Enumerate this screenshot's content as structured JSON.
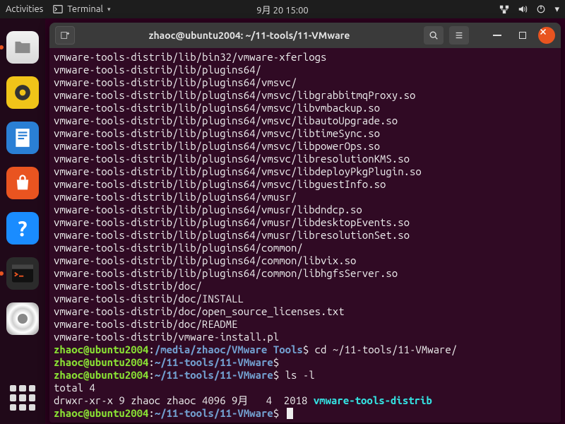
{
  "topbar": {
    "activities": "Activities",
    "app_menu": "Terminal",
    "datetime": "9月 20  15:00"
  },
  "dock": {
    "items": [
      {
        "name": "files",
        "label": "Files"
      },
      {
        "name": "rhythmbox",
        "label": "Rhythmbox"
      },
      {
        "name": "writer",
        "label": "LibreOffice Writer"
      },
      {
        "name": "software",
        "label": "Ubuntu Software"
      },
      {
        "name": "help",
        "label": "Help"
      },
      {
        "name": "terminal",
        "label": "Terminal"
      },
      {
        "name": "dvd",
        "label": "VMware Tools DVD"
      },
      {
        "name": "show-apps",
        "label": "Show Applications"
      }
    ]
  },
  "window": {
    "title": "zhaoc@ubuntu2004: ~/11-tools/11-VMware"
  },
  "terminal": {
    "output": [
      "vmware-tools-distrib/lib/bin32/vmware-xferlogs",
      "vmware-tools-distrib/lib/plugins64/",
      "vmware-tools-distrib/lib/plugins64/vmsvc/",
      "vmware-tools-distrib/lib/plugins64/vmsvc/libgrabbitmqProxy.so",
      "vmware-tools-distrib/lib/plugins64/vmsvc/libvmbackup.so",
      "vmware-tools-distrib/lib/plugins64/vmsvc/libautoUpgrade.so",
      "vmware-tools-distrib/lib/plugins64/vmsvc/libtimeSync.so",
      "vmware-tools-distrib/lib/plugins64/vmsvc/libpowerOps.so",
      "vmware-tools-distrib/lib/plugins64/vmsvc/libresolutionKMS.so",
      "vmware-tools-distrib/lib/plugins64/vmsvc/libdeployPkgPlugin.so",
      "vmware-tools-distrib/lib/plugins64/vmsvc/libguestInfo.so",
      "vmware-tools-distrib/lib/plugins64/vmusr/",
      "vmware-tools-distrib/lib/plugins64/vmusr/libdndcp.so",
      "vmware-tools-distrib/lib/plugins64/vmusr/libdesktopEvents.so",
      "vmware-tools-distrib/lib/plugins64/vmusr/libresolutionSet.so",
      "vmware-tools-distrib/lib/plugins64/common/",
      "vmware-tools-distrib/lib/plugins64/common/libvix.so",
      "vmware-tools-distrib/lib/plugins64/common/libhgfsServer.so",
      "vmware-tools-distrib/doc/",
      "vmware-tools-distrib/doc/INSTALL",
      "vmware-tools-distrib/doc/open_source_licenses.txt",
      "vmware-tools-distrib/doc/README",
      "vmware-tools-distrib/vmware-install.pl"
    ],
    "prompts": [
      {
        "user": "zhaoc@ubuntu2004",
        "sep": ":",
        "path": "/media/zhaoc/VMware Tools",
        "sym": "$",
        "cmd": " cd ~/11-tools/11-VMware/"
      },
      {
        "user": "zhaoc@ubuntu2004",
        "sep": ":",
        "path": "~/11-tools/11-VMware",
        "sym": "$",
        "cmd": ""
      },
      {
        "user": "zhaoc@ubuntu2004",
        "sep": ":",
        "path": "~/11-tools/11-VMware",
        "sym": "$",
        "cmd": " ls -l"
      }
    ],
    "ls_output": {
      "total": "total 4",
      "perm": "drwxr-xr-x 9 zhaoc zhaoc 4096 9月   4  2018 ",
      "dir": "vmware-tools-distrib"
    },
    "final_prompt": {
      "user": "zhaoc@ubuntu2004",
      "sep": ":",
      "path": "~/11-tools/11-VMware",
      "sym": "$",
      "cmd": " "
    }
  }
}
